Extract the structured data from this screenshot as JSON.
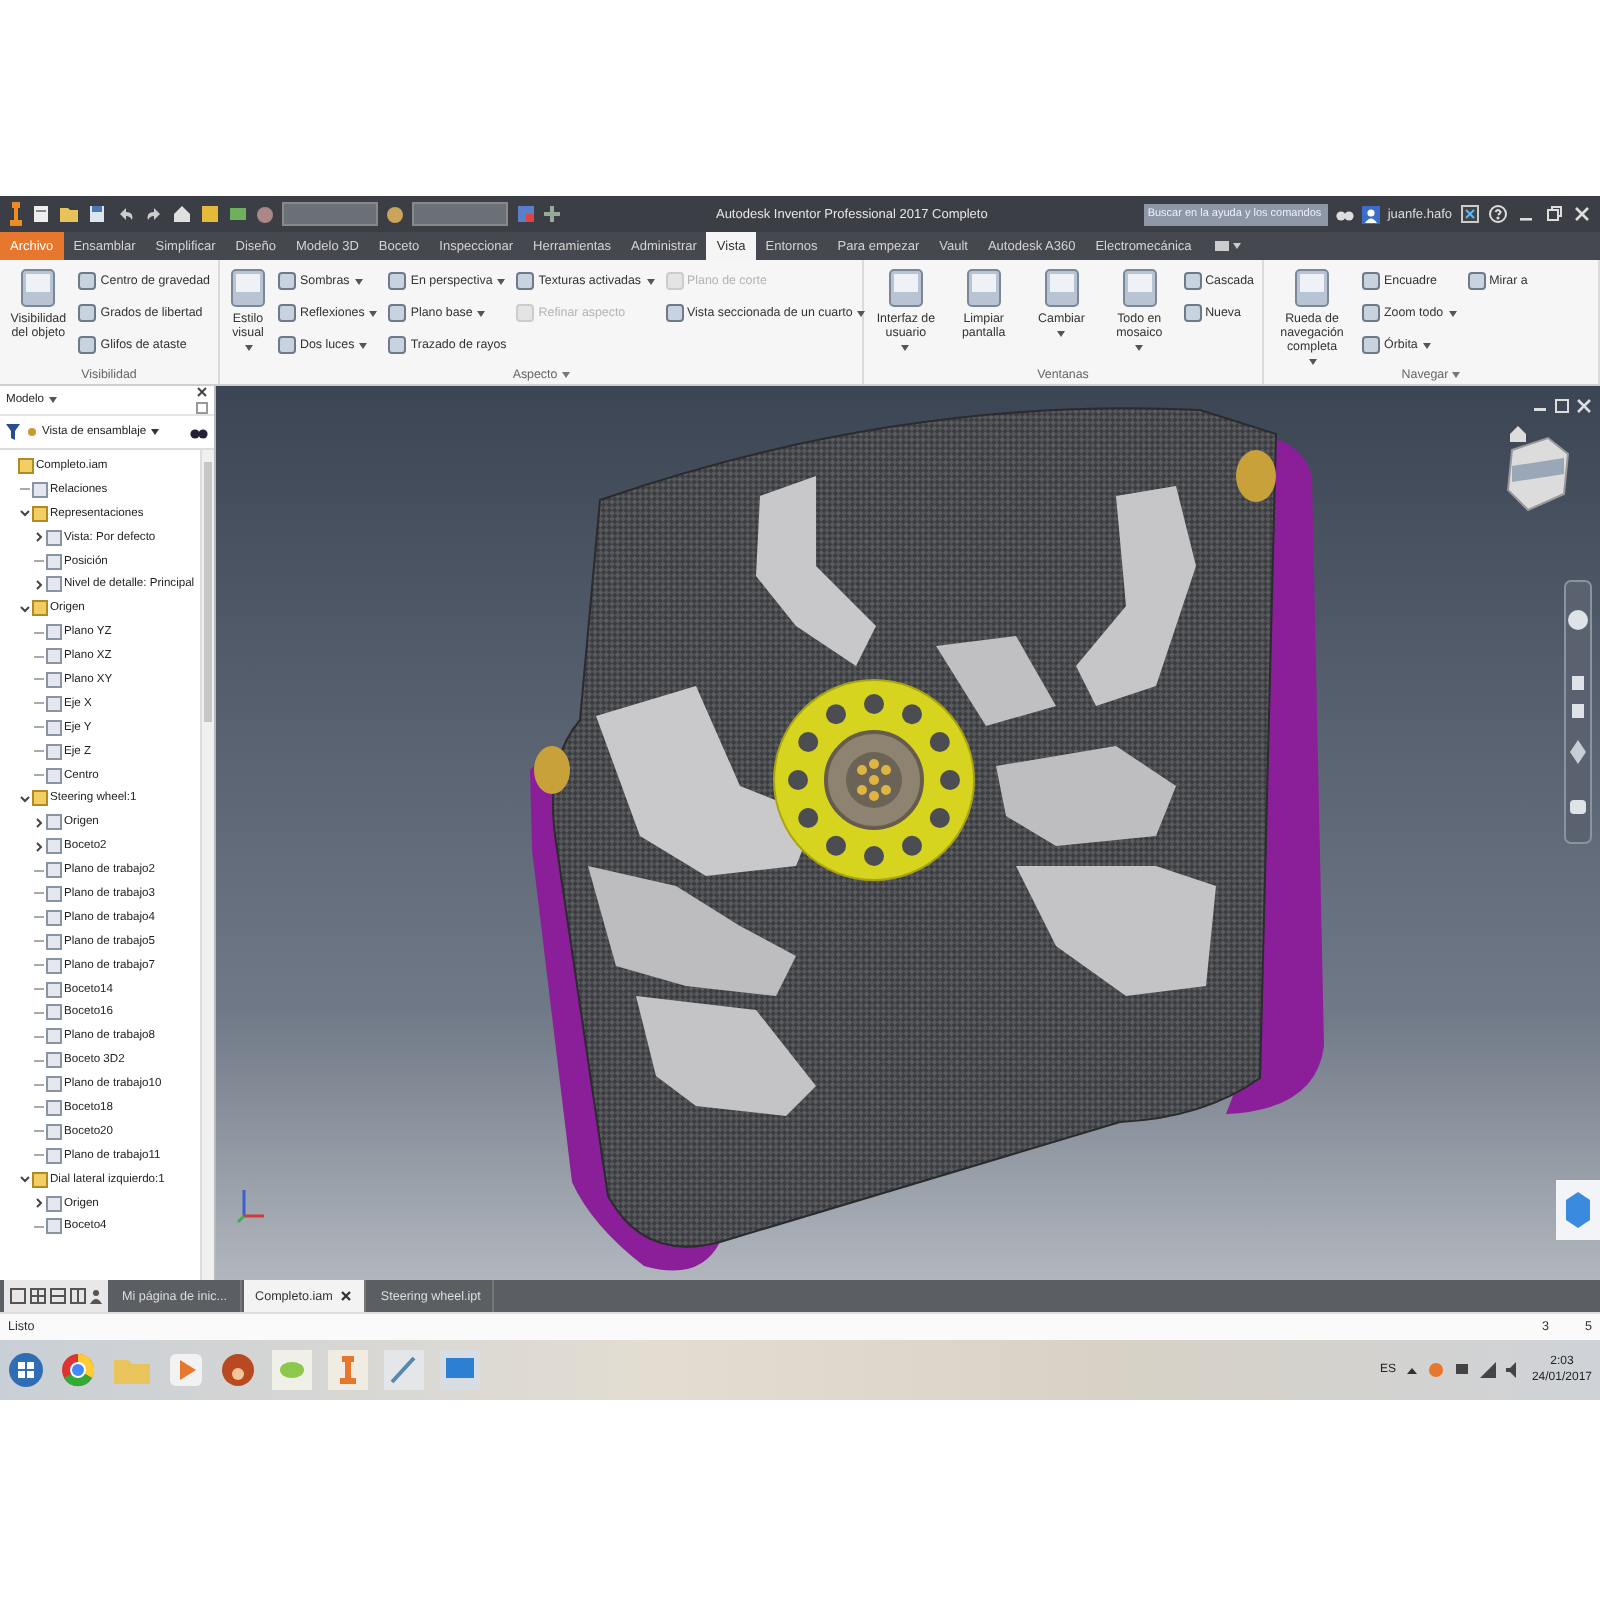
{
  "title_bar": {
    "title": "Autodesk Inventor Professional 2017   Completo",
    "search": {
      "placeholder": "Buscar en la ayuda y los comandos"
    },
    "user": "juanfe.hafo"
  },
  "ribbon_tabs": [
    {
      "label": "Archivo",
      "kind": "file",
      "selected": false
    },
    {
      "label": "Ensamblar",
      "kind": "tab",
      "selected": false
    },
    {
      "label": "Simplificar",
      "kind": "tab",
      "selected": false
    },
    {
      "label": "Diseño",
      "kind": "tab",
      "selected": false
    },
    {
      "label": "Modelo 3D",
      "kind": "tab",
      "selected": false
    },
    {
      "label": "Boceto",
      "kind": "tab",
      "selected": false
    },
    {
      "label": "Inspeccionar",
      "kind": "tab",
      "selected": false
    },
    {
      "label": "Herramientas",
      "kind": "tab",
      "selected": false
    },
    {
      "label": "Administrar",
      "kind": "tab",
      "selected": false
    },
    {
      "label": "Vista",
      "kind": "tab",
      "selected": true
    },
    {
      "label": "Entornos",
      "kind": "tab",
      "selected": false
    },
    {
      "label": "Para empezar",
      "kind": "tab",
      "selected": false
    },
    {
      "label": "Vault",
      "kind": "tab",
      "selected": false
    },
    {
      "label": "Autodesk A360",
      "kind": "tab",
      "selected": false
    },
    {
      "label": "Electromecánica",
      "kind": "tab",
      "selected": false
    }
  ],
  "ribbon_panels": [
    {
      "title": "Visibilidad",
      "menu": false,
      "groups": [
        {
          "kind": "large",
          "label": "Visibilidad del objeto",
          "menu": false,
          "disabled": false
        },
        {
          "kind": "stack",
          "items": [
            {
              "label": "Centro de gravedad",
              "menu": false,
              "disabled": false
            },
            {
              "label": "Grados de libertad",
              "menu": false,
              "disabled": false
            },
            {
              "label": "Glifos de ataste",
              "menu": false,
              "disabled": false
            }
          ]
        }
      ]
    },
    {
      "title": "Aspecto",
      "menu": true,
      "groups": [
        {
          "kind": "large",
          "label": "Estilo visual",
          "menu": true,
          "disabled": false
        },
        {
          "kind": "stack",
          "items": [
            {
              "label": "Sombras",
              "menu": true,
              "disabled": false
            },
            {
              "label": "Reflexiones",
              "menu": true,
              "disabled": false
            },
            {
              "label": "Dos luces",
              "menu": true,
              "disabled": false
            }
          ]
        },
        {
          "kind": "stack",
          "items": [
            {
              "label": "En perspectiva",
              "menu": true,
              "disabled": false
            },
            {
              "label": "Plano base",
              "menu": true,
              "disabled": false
            },
            {
              "label": "Trazado de rayos",
              "menu": false,
              "disabled": false
            }
          ]
        },
        {
          "kind": "stack",
          "items": [
            {
              "label": "Texturas activadas",
              "menu": true,
              "disabled": false
            },
            {
              "label": "Refinar aspecto",
              "menu": false,
              "disabled": true
            }
          ]
        },
        {
          "kind": "stack",
          "items": [
            {
              "label": "Plano de corte",
              "menu": false,
              "disabled": true
            },
            {
              "label": "Vista seccionada de un cuarto",
              "menu": true,
              "disabled": false
            }
          ]
        }
      ]
    },
    {
      "title": "Ventanas",
      "menu": false,
      "groups": [
        {
          "kind": "large",
          "label": "Interfaz de usuario",
          "menu": true,
          "disabled": false
        },
        {
          "kind": "large",
          "label": "Limpiar pantalla",
          "menu": false,
          "disabled": false
        },
        {
          "kind": "large",
          "label": "Cambiar",
          "menu": true,
          "disabled": false
        },
        {
          "kind": "large",
          "label": "Todo en mosaico",
          "menu": true,
          "disabled": false
        },
        {
          "kind": "stack",
          "items": [
            {
              "label": "Cascada",
              "menu": false,
              "disabled": false
            },
            {
              "label": "Nueva",
              "menu": false,
              "disabled": false
            }
          ]
        }
      ]
    },
    {
      "title": "Navegar",
      "menu": true,
      "groups": [
        {
          "kind": "large",
          "label": "Rueda de navegación completa",
          "menu": true,
          "disabled": false
        },
        {
          "kind": "stack",
          "items": [
            {
              "label": "Encuadre",
              "menu": false,
              "disabled": false
            },
            {
              "label": "Zoom todo",
              "menu": true,
              "disabled": false
            },
            {
              "label": "Órbita",
              "menu": true,
              "disabled": false
            }
          ]
        },
        {
          "kind": "stack",
          "items": [
            {
              "label": "Mirar a",
              "menu": false,
              "disabled": false
            }
          ]
        }
      ]
    }
  ],
  "browser": {
    "title": "Modelo",
    "view": "Vista de ensamblaje",
    "tree": [
      {
        "label": "Completo.iam",
        "children": [
          {
            "label": "Relaciones"
          },
          {
            "label": "Representaciones",
            "expanded": true,
            "children": [
              {
                "label": "Vista: Por defecto",
                "expanded": false
              },
              {
                "label": "Posición"
              },
              {
                "label": "Nivel de detalle: Principal",
                "expanded": false
              }
            ]
          },
          {
            "label": "Origen",
            "expanded": true,
            "children": [
              {
                "label": "Plano YZ"
              },
              {
                "label": "Plano XZ"
              },
              {
                "label": "Plano XY"
              },
              {
                "label": "Eje X"
              },
              {
                "label": "Eje Y"
              },
              {
                "label": "Eje Z"
              },
              {
                "label": "Centro"
              }
            ]
          },
          {
            "label": "Steering wheel:1",
            "expanded": true,
            "children": [
              {
                "label": "Origen",
                "expanded": false
              },
              {
                "label": "Boceto2",
                "expanded": false
              },
              {
                "label": "Plano de trabajo2"
              },
              {
                "label": "Plano de trabajo3"
              },
              {
                "label": "Plano de trabajo4"
              },
              {
                "label": "Plano de trabajo5"
              },
              {
                "label": "Plano de trabajo7"
              },
              {
                "label": "Boceto14"
              },
              {
                "label": "Boceto16"
              },
              {
                "label": "Plano de trabajo8"
              },
              {
                "label": "Boceto 3D2"
              },
              {
                "label": "Plano de trabajo10"
              },
              {
                "label": "Boceto18"
              },
              {
                "label": "Boceto20"
              },
              {
                "label": "Plano de trabajo11"
              }
            ]
          },
          {
            "label": "Dial lateral izquierdo:1",
            "expanded": true,
            "children": [
              {
                "label": "Origen",
                "expanded": false
              },
              {
                "label": "Boceto4"
              }
            ]
          }
        ]
      }
    ]
  },
  "document_tabs": [
    {
      "label": "Mi página de inic...",
      "selected": false
    },
    {
      "label": "Completo.iam",
      "selected": true
    },
    {
      "label": "Steering wheel.ipt",
      "selected": false
    }
  ],
  "status_bar": {
    "message": "Listo",
    "count_1": "3",
    "count_2": "5"
  },
  "taskbar": {
    "language": "ES",
    "time": "2:03",
    "date": "24/01/2017"
  }
}
